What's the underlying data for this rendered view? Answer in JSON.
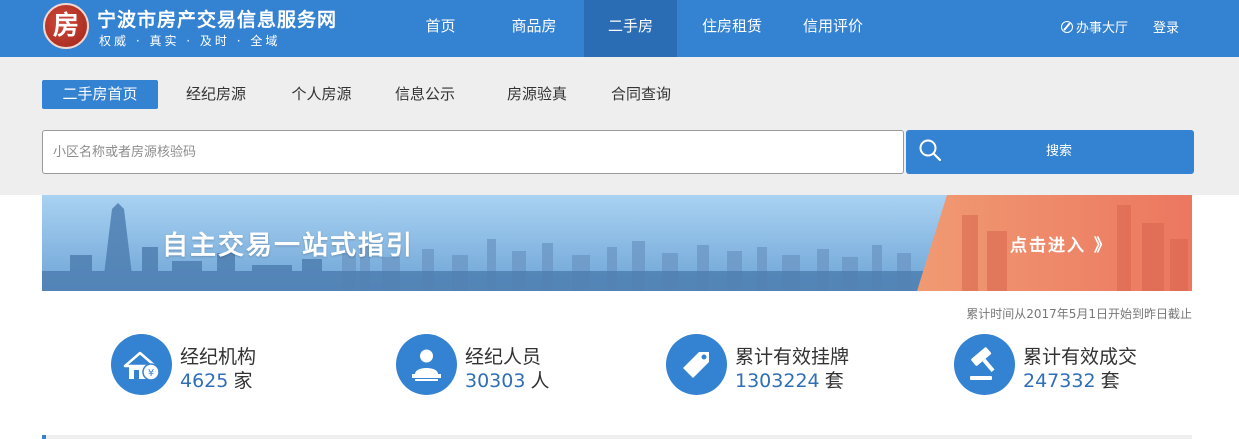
{
  "header": {
    "logo_glyph": "房",
    "site_title": "宁波市房产交易信息服务网",
    "slogan": "权威 · 真实 · 及时 · 全域",
    "nav": [
      "首页",
      "商品房",
      "二手房",
      "住房租赁",
      "信用评价"
    ],
    "active_nav": "二手房",
    "office_label": "办事大厅",
    "login_label": "登录"
  },
  "subnav": {
    "items": [
      "二手房首页",
      "经纪房源",
      "个人房源",
      "信息公示",
      "房源验真",
      "合同查询"
    ],
    "active": "二手房首页"
  },
  "search": {
    "placeholder": "小区名称或者房源核验码",
    "value": "",
    "button_label": "搜索"
  },
  "banner": {
    "title": "自主交易一站式指引",
    "enter_label": "点击进入 》"
  },
  "stats": {
    "note": "累计时间从2017年5月1日开始到昨日截止",
    "items": [
      {
        "label": "经纪机构",
        "value": "4625",
        "unit": "家",
        "icon": "agency-house-icon"
      },
      {
        "label": "经纪人员",
        "value": "30303",
        "unit": "人",
        "icon": "agent-person-icon"
      },
      {
        "label": "累计有效挂牌",
        "value": "1303224",
        "unit": "套",
        "icon": "price-tag-icon"
      },
      {
        "label": "累计有效成交",
        "value": "247332",
        "unit": "套",
        "icon": "gavel-icon"
      }
    ]
  },
  "colors": {
    "brand_blue": "#3482d2",
    "nav_active": "#2a6db4",
    "value_blue": "#2f6fb8",
    "banner_orange": "#ee7a5c",
    "grey_band": "#eeeeee"
  }
}
